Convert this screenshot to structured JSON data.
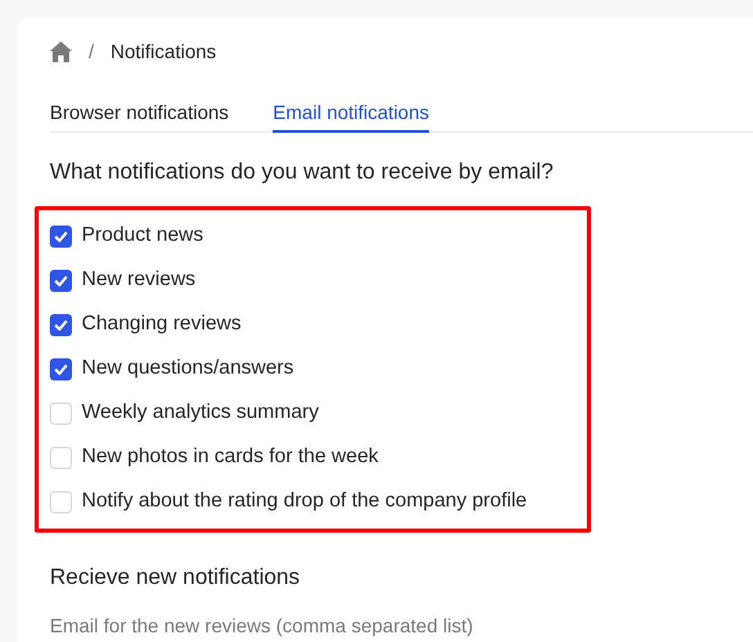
{
  "breadcrumb": {
    "current": "Notifications",
    "separator": "/"
  },
  "tabs": [
    {
      "label": "Browser notifications",
      "selected": false
    },
    {
      "label": "Email notifications",
      "selected": true
    }
  ],
  "question": "What notifications do you want to receive by email?",
  "options": [
    {
      "label": "Product news",
      "checked": true
    },
    {
      "label": "New reviews",
      "checked": true
    },
    {
      "label": "Changing reviews",
      "checked": true
    },
    {
      "label": "New questions/answers",
      "checked": true
    },
    {
      "label": "Weekly analytics summary",
      "checked": false
    },
    {
      "label": "New photos in cards for the week",
      "checked": false
    },
    {
      "label": "Notify about the rating drop of the company profile",
      "checked": false
    }
  ],
  "section_title": "Recieve new notifications",
  "field_label": "Email for the new reviews (comma separated list)"
}
